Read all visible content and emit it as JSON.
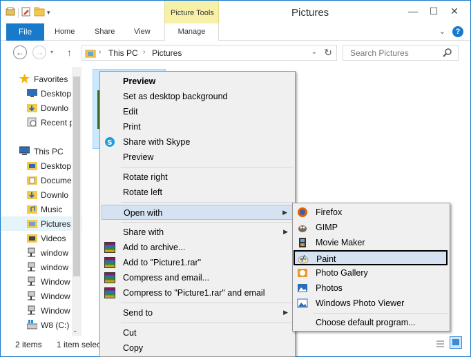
{
  "window": {
    "title": "Pictures",
    "contextual_tab_group": "Picture Tools",
    "controls": {
      "minimize": "—",
      "maximize": "☐",
      "close": "✕"
    }
  },
  "ribbon": {
    "file_tab": "File",
    "tabs": [
      "Home",
      "Share",
      "View"
    ],
    "manage_tab": "Manage",
    "help": "?"
  },
  "address": {
    "breadcrumbs": [
      "This PC",
      "Pictures"
    ],
    "separator": "›",
    "search_placeholder": "Search Pictures"
  },
  "navpane": {
    "favorites": "Favorites",
    "favorite_items": [
      "Desktop",
      "Downlo",
      "Recent p"
    ],
    "this_pc": "This PC",
    "pc_items": [
      "Desktop",
      "Docume",
      "Downlo",
      "Music",
      "Pictures",
      "Videos",
      "window",
      "window",
      "Window",
      "Window",
      "Window",
      "W8 (C:)"
    ]
  },
  "status": {
    "items": "2 items",
    "selected": "1 item selec"
  },
  "context_menu": {
    "items": [
      "Preview",
      "Set as desktop background",
      "Edit",
      "Print",
      "Share with Skype",
      "Preview",
      "Rotate right",
      "Rotate left",
      "Open with",
      "Share with",
      "Add to archive...",
      "Add to \"Picture1.rar\"",
      "Compress and email...",
      "Compress to \"Picture1.rar\" and email",
      "Send to",
      "Cut",
      "Copy"
    ]
  },
  "open_with_menu": {
    "items": [
      "Firefox",
      "GIMP",
      "Movie Maker",
      "Paint",
      "Photo Gallery",
      "Photos",
      "Windows Photo Viewer",
      "Choose default program..."
    ]
  }
}
